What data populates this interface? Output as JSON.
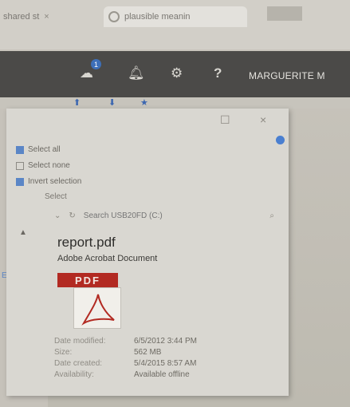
{
  "browser": {
    "tabs": [
      {
        "label": "shared st",
        "close": "×"
      },
      {
        "label": "plausible meanin",
        "close": ""
      }
    ]
  },
  "appbar": {
    "badge_count": "1",
    "user_name": "MARGUERITE M",
    "icons": [
      "cloud-notify-icon",
      "bell-icon",
      "gear-icon",
      "help-icon"
    ]
  },
  "dialog": {
    "controls": {
      "maximize": "☐",
      "close": "×"
    },
    "menu": {
      "select_all": "Select all",
      "select_none": "Select none",
      "invert_selection": "Invert selection",
      "select_group": "Select"
    },
    "search_placeholder": "Search USB20FD (C:)"
  },
  "details": {
    "file_name": "report.pdf",
    "file_type": "Adobe Acrobat Document",
    "icon_label": "PDF",
    "metadata": [
      {
        "key": "Date modified:",
        "value": "6/5/2012 3:44 PM"
      },
      {
        "key": "Size:",
        "value": "562 MB"
      },
      {
        "key": "Date created:",
        "value": "5/4/2015 8:57 AM"
      },
      {
        "key": "Availability:",
        "value": "Available offline"
      }
    ]
  },
  "colors": {
    "appbar_bg": "#4b4a48",
    "accent_blue": "#4a7fd0",
    "pdf_red": "#b22a22"
  }
}
